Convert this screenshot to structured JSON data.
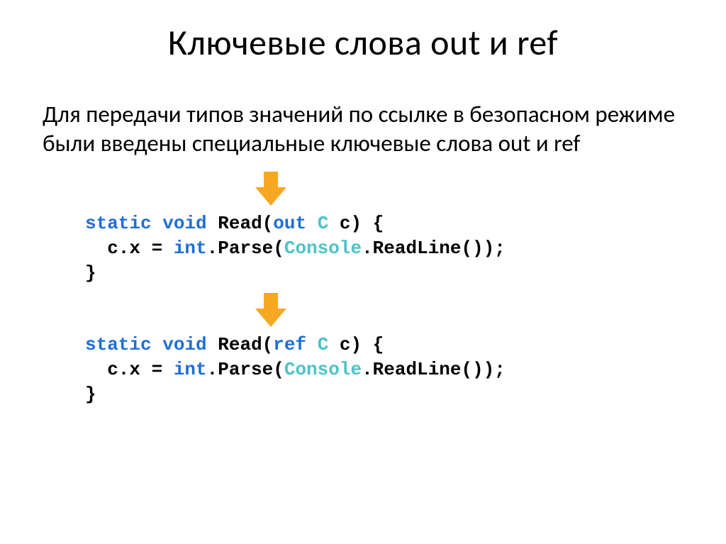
{
  "title": "Ключевые слова out и ref",
  "paragraph": "Для передачи типов значений по ссылке в безопасном режиме были введены специальные ключевые слова out и ref",
  "code1": {
    "kw_static": "static",
    "kw_void": "void",
    "read_open": " Read(",
    "kw_out": "out",
    "sp": " ",
    "type_C": "C",
    "sig_close": " c) {",
    "line2a": "  c.x = ",
    "kw_int": "int",
    "line2b": ".Parse(",
    "type_Console": "Console",
    "line2c": ".ReadLine());",
    "line3": "}"
  },
  "code2": {
    "kw_static": "static",
    "kw_void": "void",
    "read_open": " Read(",
    "kw_ref": "ref",
    "sp": " ",
    "type_C": "C",
    "sig_close": " c) {",
    "line2a": "  c.x = ",
    "kw_int": "int",
    "line2b": ".Parse(",
    "type_Console": "Console",
    "line2c": ".ReadLine());",
    "line3": "}"
  }
}
